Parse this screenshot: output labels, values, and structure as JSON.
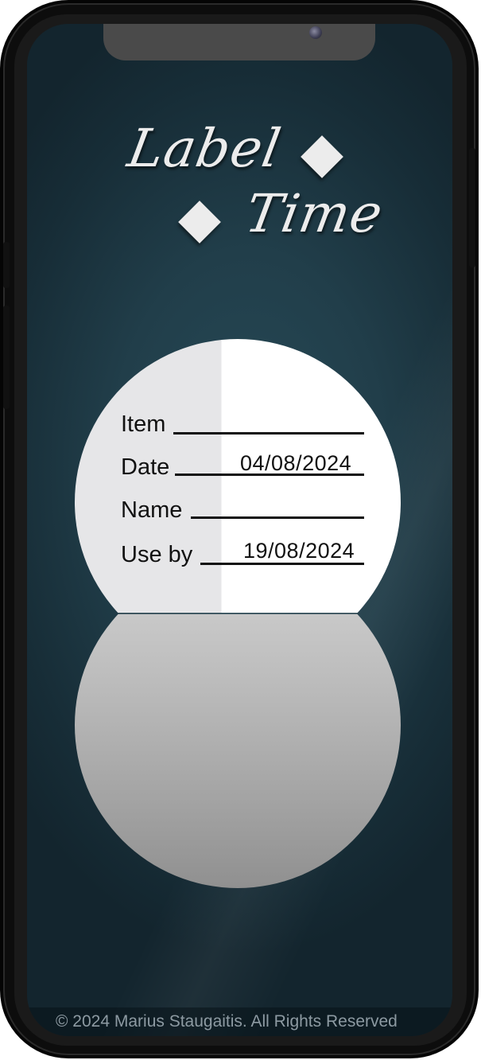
{
  "logo": {
    "word1": "Label",
    "word2": "Time"
  },
  "label": {
    "fields": [
      {
        "name": "Item",
        "value": ""
      },
      {
        "name": "Date",
        "value": "04/08/2024"
      },
      {
        "name": "Name",
        "value": ""
      },
      {
        "name": "Use by",
        "value": "19/08/2024"
      }
    ]
  },
  "footer": {
    "copyright": "© 2024 Marius Staugaitis. All Rights Reserved"
  },
  "colors": {
    "background": "#213e4a",
    "label_white": "#ffffff",
    "label_shade": "#e6e6e8",
    "text": "#111111"
  }
}
